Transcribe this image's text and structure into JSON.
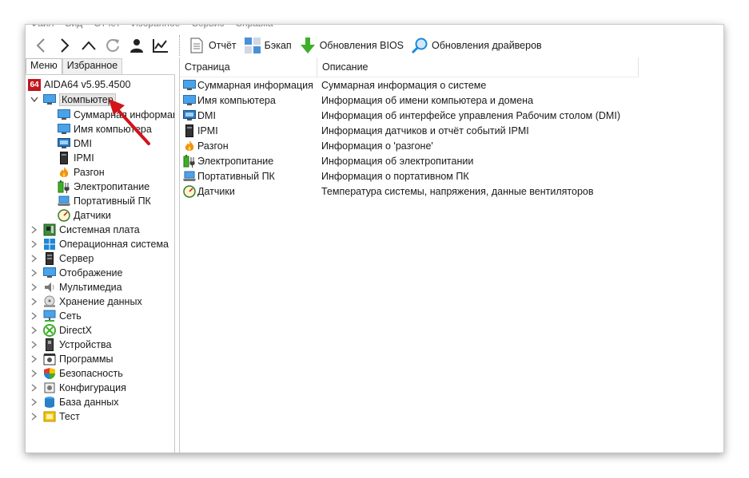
{
  "menubar": [
    "Файл",
    "Вид",
    "Отчёт",
    "Избранное",
    "Сервис",
    "Справка"
  ],
  "toolbar": {
    "report": "Отчёт",
    "backup": "Бэкап",
    "bios_update": "Обновления BIOS",
    "driver_update": "Обновления драйверов"
  },
  "tabs": {
    "menu": "Меню",
    "favorites": "Избранное"
  },
  "tree": {
    "root": "AIDA64 v5.95.4500",
    "root_badge": "64",
    "computer": "Компьютер",
    "computer_children": [
      "Суммарная информация",
      "Имя компьютера",
      "DMI",
      "IPMI",
      "Разгон",
      "Электропитание",
      "Портативный ПК",
      "Датчики"
    ],
    "categories": [
      "Системная плата",
      "Операционная система",
      "Сервер",
      "Отображение",
      "Мультимедиа",
      "Хранение данных",
      "Сеть",
      "DirectX",
      "Устройства",
      "Программы",
      "Безопасность",
      "Конфигурация",
      "База данных",
      "Тест"
    ]
  },
  "list": {
    "col_page": "Страница",
    "col_desc": "Описание",
    "rows": [
      {
        "page": "Суммарная информация",
        "desc": "Суммарная информация о системе",
        "icon": "monitor-icon"
      },
      {
        "page": "Имя компьютера",
        "desc": "Информация об имени компьютера и домена",
        "icon": "monitor-icon"
      },
      {
        "page": "DMI",
        "desc": "Информация об интерфейсе управления Рабочим столом (DMI)",
        "icon": "dmi-icon"
      },
      {
        "page": "IPMI",
        "desc": "Информация датчиков и отчёт событий IPMI",
        "icon": "ipmi-icon"
      },
      {
        "page": "Разгон",
        "desc": "Информация о 'разгоне'",
        "icon": "fire-icon"
      },
      {
        "page": "Электропитание",
        "desc": "Информация об электропитании",
        "icon": "battery-icon"
      },
      {
        "page": "Портативный ПК",
        "desc": "Информация о портативном ПК",
        "icon": "laptop-icon"
      },
      {
        "page": "Датчики",
        "desc": "Температура системы, напряжения, данные вентиляторов",
        "icon": "gauge-icon"
      }
    ]
  },
  "colors": {
    "accent_blue": "#1e88d8",
    "selection": "#e6e6e6",
    "arrow_red": "#d0151b"
  }
}
